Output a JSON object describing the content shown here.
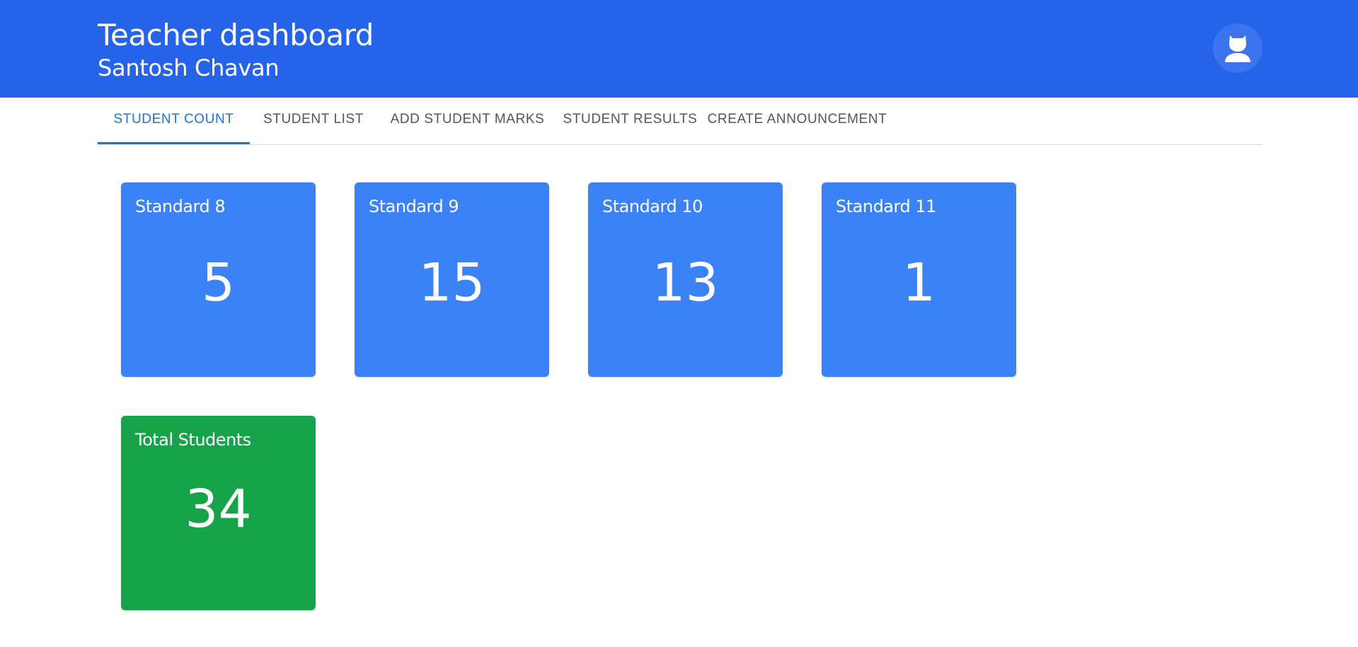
{
  "header": {
    "title": "Teacher dashboard",
    "subtitle": "Santosh Chavan",
    "avatar_icon": "user-icon",
    "background": "#2563eb"
  },
  "tabs": [
    {
      "label": "STUDENT COUNT",
      "active": true
    },
    {
      "label": "STUDENT LIST",
      "active": false
    },
    {
      "label": "ADD STUDENT MARKS",
      "active": false
    },
    {
      "label": "STUDENT RESULTS",
      "active": false
    },
    {
      "label": "CREATE ANNOUNCEMENT",
      "active": false
    }
  ],
  "cards": [
    {
      "label": "Standard 8",
      "value": "5"
    },
    {
      "label": "Standard 9",
      "value": "15"
    },
    {
      "label": "Standard 10",
      "value": "13"
    },
    {
      "label": "Standard 11",
      "value": "1"
    }
  ],
  "total": {
    "label": "Total Students",
    "value": "34"
  },
  "colors": {
    "accent": "#1976d2",
    "card_blue": "#3b82f6",
    "card_green": "#16a34a"
  }
}
